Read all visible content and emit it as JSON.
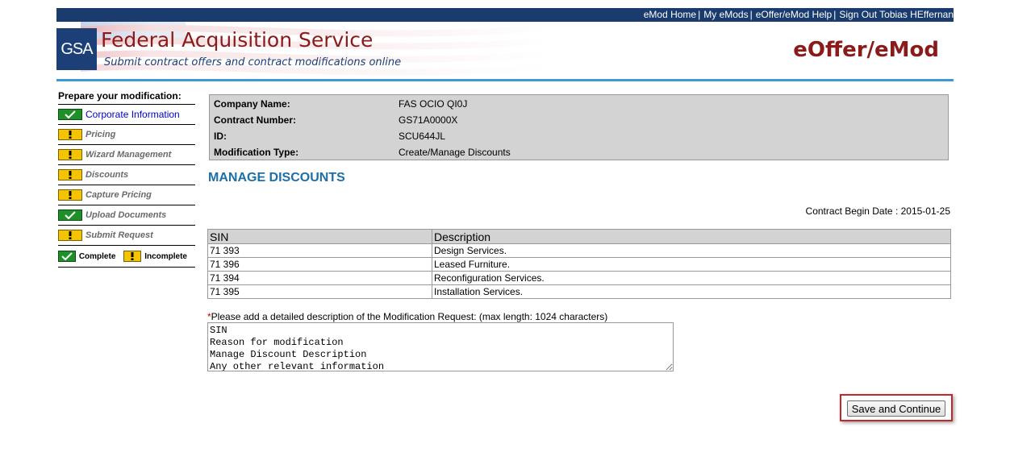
{
  "topnav": {
    "links": [
      "eMod Home",
      "My eMods",
      "eOffer/eMod Help",
      "Sign Out Tobias HEffernan"
    ]
  },
  "header": {
    "logo_text": "GSA",
    "title": "Federal Acquisition Service",
    "subtitle": "Submit contract offers and contract modifications online",
    "brand": "eOffer/eMod"
  },
  "sidebar": {
    "title": "Prepare your modification:",
    "items": [
      {
        "label": "Corporate Information",
        "status": "complete",
        "icon": "check-icon"
      },
      {
        "label": "Pricing",
        "status": "incomplete",
        "icon": "exclamation-icon"
      },
      {
        "label": "Wizard Management",
        "status": "incomplete",
        "icon": "exclamation-icon"
      },
      {
        "label": "Discounts",
        "status": "incomplete",
        "icon": "exclamation-icon"
      },
      {
        "label": "Capture Pricing",
        "status": "incomplete",
        "icon": "exclamation-icon"
      },
      {
        "label": "Upload Documents",
        "status": "complete",
        "icon": "check-icon"
      },
      {
        "label": "Submit Request",
        "status": "incomplete",
        "icon": "exclamation-icon"
      }
    ],
    "legend": {
      "complete": "Complete",
      "incomplete": "Incomplete"
    }
  },
  "info": {
    "rows": [
      {
        "label": "Company Name:",
        "value": "FAS OCIO QI0J"
      },
      {
        "label": "Contract Number:",
        "value": "GS71A0000X"
      },
      {
        "label": "ID:",
        "value": "SCU644JL"
      },
      {
        "label": "Modification Type:",
        "value": "Create/Manage Discounts"
      }
    ]
  },
  "main": {
    "title": "MANAGE DISCOUNTS",
    "begin_date": "Contract Begin Date : 2015-01-25",
    "table": {
      "headers": [
        "SIN",
        "Description"
      ],
      "rows": [
        [
          "71 393",
          "Design Services."
        ],
        [
          "71 396",
          "Leased Furniture."
        ],
        [
          "71 394",
          "Reconfiguration Services."
        ],
        [
          "71 395",
          "Installation Services."
        ]
      ]
    },
    "desc_required_mark": "*",
    "desc_label": "Please add a detailed description of the Modification Request: (max length: 1024 characters)",
    "desc_value": "SIN\nReason for modification\nManage Discount Description\nAny other relevant information",
    "save_label": "Save and Continue"
  },
  "colors": {
    "nav_bg": "#1a3b6e",
    "title_red": "#8b1a1a",
    "accent_blue": "#1d6fa8",
    "complete_green": "#1f8f2a",
    "incomplete_yellow": "#f5c400",
    "highlight_red": "#c0282d"
  }
}
